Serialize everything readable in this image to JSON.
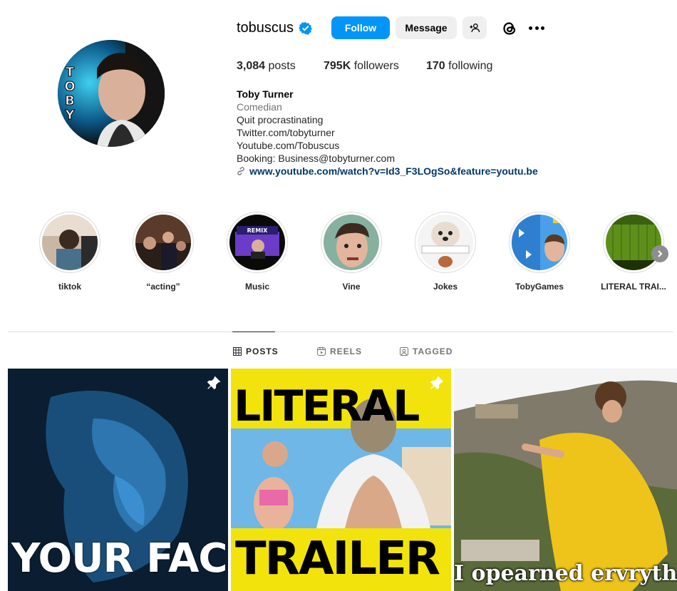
{
  "profile": {
    "username": "tobuscus",
    "verified_icon": "verified-badge-icon",
    "follow_label": "Follow",
    "message_label": "Message",
    "add_user_icon": "add-user-icon",
    "threads_icon": "threads-icon",
    "more_icon": "more-options-icon",
    "avatar_text": "TOBY"
  },
  "stats": {
    "posts_count": "3,084",
    "posts_label": " posts",
    "followers_count": "795K",
    "followers_label": " followers",
    "following_count": "170",
    "following_label": " following"
  },
  "bio": {
    "name": "Toby Turner",
    "category": "Comedian",
    "lines": [
      "Quit procrastinating",
      "Twitter.com/tobyturner",
      "Youtube.com/Tobuscus",
      "Booking: Business@tobyturner.com"
    ],
    "link": "www.youtube.com/watch?v=Id3_F3LOgSo&feature=youtu.be"
  },
  "highlights": [
    {
      "label": "tiktok"
    },
    {
      "label": "“acting”"
    },
    {
      "label": "Music",
      "thumb_text": "REMIX"
    },
    {
      "label": "Vine"
    },
    {
      "label": "Jokes"
    },
    {
      "label": "TobyGames"
    },
    {
      "label": "LITERAL TRAI..."
    }
  ],
  "tabs": {
    "posts": "POSTS",
    "reels": "REELS",
    "tagged": "TAGGED"
  },
  "posts": [
    {
      "overlay": "YOUR FACE",
      "pinned": true
    },
    {
      "overlay_top": "LITERAL",
      "overlay_bottom": "TRAILER",
      "pinned": true
    },
    {
      "overlay": "I opearned ervrytha",
      "pinned": false
    }
  ],
  "colors": {
    "accent": "#0095f6",
    "link": "#00376b",
    "muted": "#737373"
  }
}
